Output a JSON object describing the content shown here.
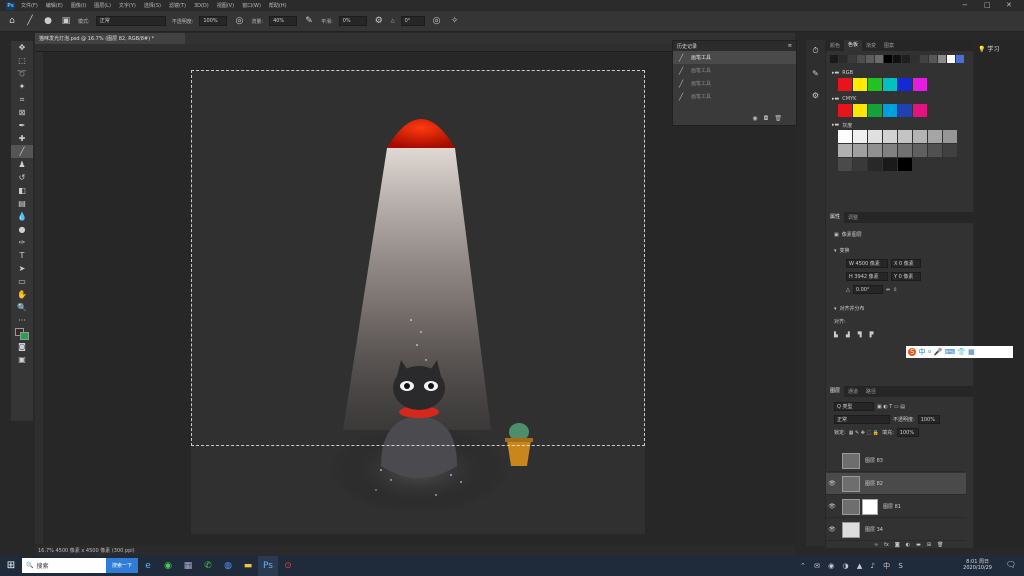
{
  "menubar": {
    "logo": "Ps",
    "items": [
      "文件(F)",
      "编辑(E)",
      "图像(I)",
      "图层(L)",
      "文字(Y)",
      "选择(S)",
      "滤镜(T)",
      "3D(D)",
      "视图(V)",
      "窗口(W)",
      "帮助(H)"
    ],
    "min": "−",
    "max": "□",
    "close": "✕"
  },
  "options": {
    "mode_label": "模式:",
    "mode_value": "正常",
    "opacity_label": "不透明度:",
    "opacity_value": "100%",
    "flow_label": "流量:",
    "flow_value": "40%",
    "smooth_label": "平滑:",
    "smooth_value": "0%",
    "angle_value": "0°"
  },
  "document": {
    "tab": "猫咪发光灯泡.psd @ 16.7% (图层 82, RGB/8#) *",
    "status": "16.7%   4500 像素 x 4500 像素 (300 ppi)"
  },
  "history": {
    "title": "历史记录",
    "rows": [
      "画笔工具",
      "画笔工具",
      "画笔工具",
      "画笔工具"
    ]
  },
  "swatches": {
    "tabs": [
      "颜色",
      "色板",
      "渐变",
      "图案"
    ],
    "groups": [
      "RGB",
      "CMYK",
      "灰度"
    ],
    "colors": {
      "top": [
        "#1a1a1a",
        "#2a2a2a",
        "#3a3a3a",
        "#4d4d4d",
        "#5c5c5c",
        "#6b6b6b",
        "#000000",
        "#111111",
        "#1f1f1f",
        "#2f2f2f",
        "#424242",
        "#575757",
        "#8a8a8a",
        "#ffffff",
        "#4b6fd8"
      ],
      "rgb": [
        "#e8141b",
        "#ffea00",
        "#22c223",
        "#00c0c0",
        "#1428d4",
        "#e31ee0"
      ],
      "cmyk": [
        "#e8141b",
        "#ffe600",
        "#13a23a",
        "#00a0e0",
        "#2041b2",
        "#e2127e"
      ],
      "gray1": [
        "#ffffff",
        "#f0f0f0",
        "#e0e0e0",
        "#d2d2d2",
        "#c3c3c3",
        "#b4b4b4",
        "#a5a5a5",
        "#969696"
      ],
      "gray2": [
        "#b0b0b0",
        "#a0a0a0",
        "#909090",
        "#808080",
        "#707070",
        "#606060",
        "#505050",
        "#404040"
      ],
      "gray3": [
        "#4a4a4a",
        "#393939",
        "#282828",
        "#1a1a1a",
        "#000000"
      ]
    }
  },
  "properties": {
    "tabs": [
      "属性",
      "调整"
    ],
    "layer_type": "像素图层",
    "transform": "变换",
    "w": "W 4500 像素",
    "x": "X 0 像素",
    "h": "H 3942 像素",
    "y": "Y 0 像素",
    "angle": "0.00°",
    "align": "对齐并分布",
    "align_label": "对齐:"
  },
  "layers": {
    "tabs": [
      "图层",
      "通道",
      "路径"
    ],
    "kind": "Q 类型",
    "blend": "正常",
    "opacity_label": "不透明度:",
    "opacity": "100%",
    "lock_label": "锁定:",
    "fill_label": "填充:",
    "fill": "100%",
    "rows": [
      {
        "name": "图层 83",
        "visible": false
      },
      {
        "name": "图层 82",
        "visible": true
      },
      {
        "name": "图层 81",
        "visible": true
      },
      {
        "name": "图层 34",
        "visible": true
      }
    ]
  },
  "learn": "学习",
  "taskbar": {
    "search_text": "搜索",
    "search_button": "搜索一下",
    "time": "8:01 周日",
    "date": "2020/10/29"
  }
}
